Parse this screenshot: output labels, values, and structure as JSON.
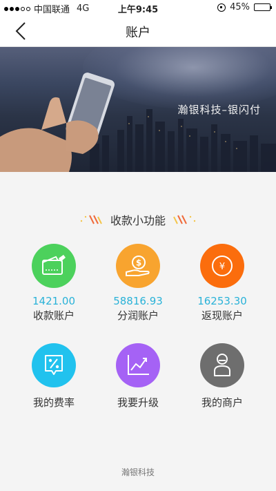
{
  "status_bar": {
    "carrier": "中国联通",
    "network": "4G",
    "time": "上午9:45",
    "battery": "45%",
    "battery_level": 0.45
  },
  "nav": {
    "title": "账户"
  },
  "banner": {
    "text": "瀚银科技–银闪付"
  },
  "section": {
    "title": "收款小功能"
  },
  "functions": [
    {
      "label": "收款账户",
      "amount": "1421.00",
      "color": "#4cd15c",
      "icon": "wallet-icon"
    },
    {
      "label": "分润账户",
      "amount": "58816.93",
      "color": "#f8a42f",
      "icon": "dollar-hand-icon"
    },
    {
      "label": "返现账户",
      "amount": "16253.30",
      "color": "#fb6d0d",
      "icon": "yen-coin-icon"
    },
    {
      "label": "我的费率",
      "color": "#21c2ee",
      "icon": "percent-tag-icon"
    },
    {
      "label": "我要升级",
      "color": "#a562f5",
      "icon": "growth-chart-icon"
    },
    {
      "label": "我的商户",
      "color": "#6e6e6e",
      "icon": "merchant-user-icon"
    }
  ],
  "footer": {
    "text": "瀚银科技"
  }
}
